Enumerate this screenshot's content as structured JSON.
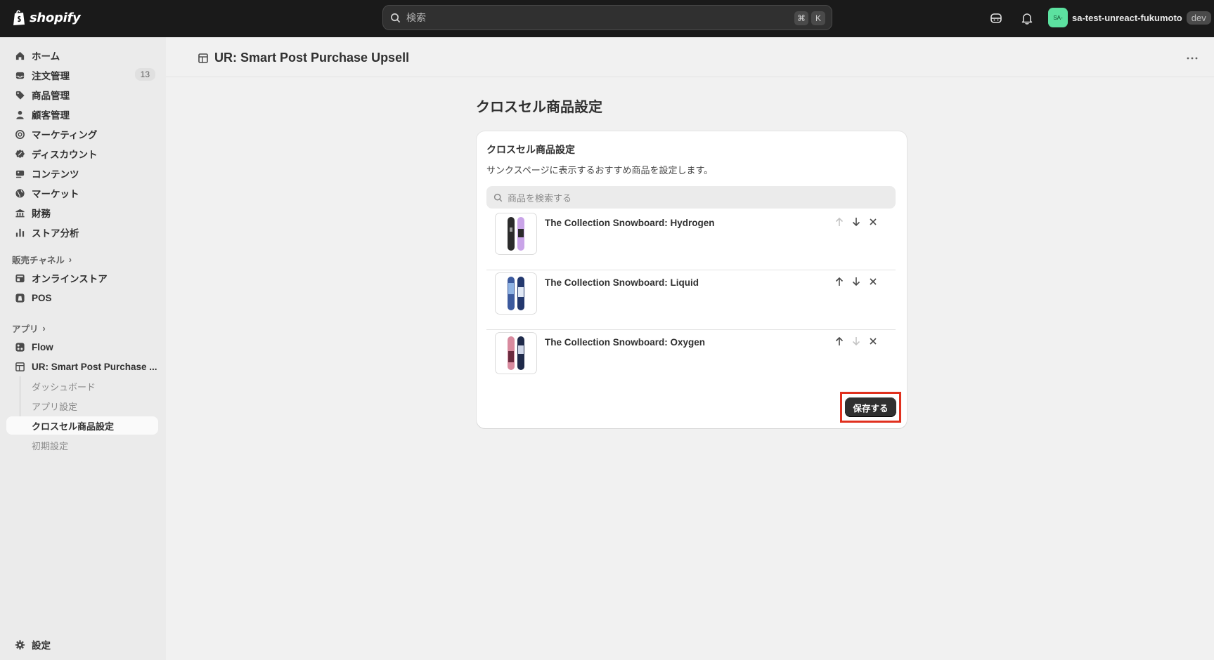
{
  "topbar": {
    "logo_text": "shopify",
    "search_placeholder": "検索",
    "shortcut_keys": [
      "⌘",
      "K"
    ],
    "account_initials": "SA-",
    "account_name": "sa-test-unreact-fukumoto",
    "account_badge": "dev"
  },
  "sidebar": {
    "items": [
      {
        "label": "ホーム",
        "icon": "home-icon"
      },
      {
        "label": "注文管理",
        "icon": "inbox-icon",
        "count": "13"
      },
      {
        "label": "商品管理",
        "icon": "tag-icon"
      },
      {
        "label": "顧客管理",
        "icon": "person-icon"
      },
      {
        "label": "マーケティング",
        "icon": "target-icon"
      },
      {
        "label": "ディスカウント",
        "icon": "discount-icon"
      },
      {
        "label": "コンテンツ",
        "icon": "content-icon"
      },
      {
        "label": "マーケット",
        "icon": "globe-icon"
      },
      {
        "label": "財務",
        "icon": "bank-icon"
      },
      {
        "label": "ストア分析",
        "icon": "chart-icon"
      }
    ],
    "sales_channels_label": "販売チャネル",
    "channels": [
      {
        "label": "オンラインストア",
        "icon": "store-icon"
      },
      {
        "label": "POS",
        "icon": "pos-icon"
      }
    ],
    "apps_label": "アプリ",
    "apps": [
      {
        "label": "Flow",
        "icon": "flow-icon"
      },
      {
        "label": "UR: Smart Post Purchase ...",
        "icon": "app-icon"
      }
    ],
    "app_subitems": [
      "ダッシュボード",
      "アプリ設定",
      "クロスセル商品設定",
      "初期設定"
    ],
    "settings_label": "設定"
  },
  "header": {
    "title": "UR: Smart Post Purchase Upsell"
  },
  "page": {
    "title": "クロスセル商品設定",
    "card_title": "クロスセル商品設定",
    "card_description": "サンクスページに表示するおすすめ商品を設定します。",
    "search_placeholder": "商品を検索する",
    "products": [
      {
        "name": "The Collection Snowboard: Hydrogen"
      },
      {
        "name": "The Collection Snowboard: Liquid"
      },
      {
        "name": "The Collection Snowboard: Oxygen"
      }
    ],
    "save_label": "保存する"
  }
}
